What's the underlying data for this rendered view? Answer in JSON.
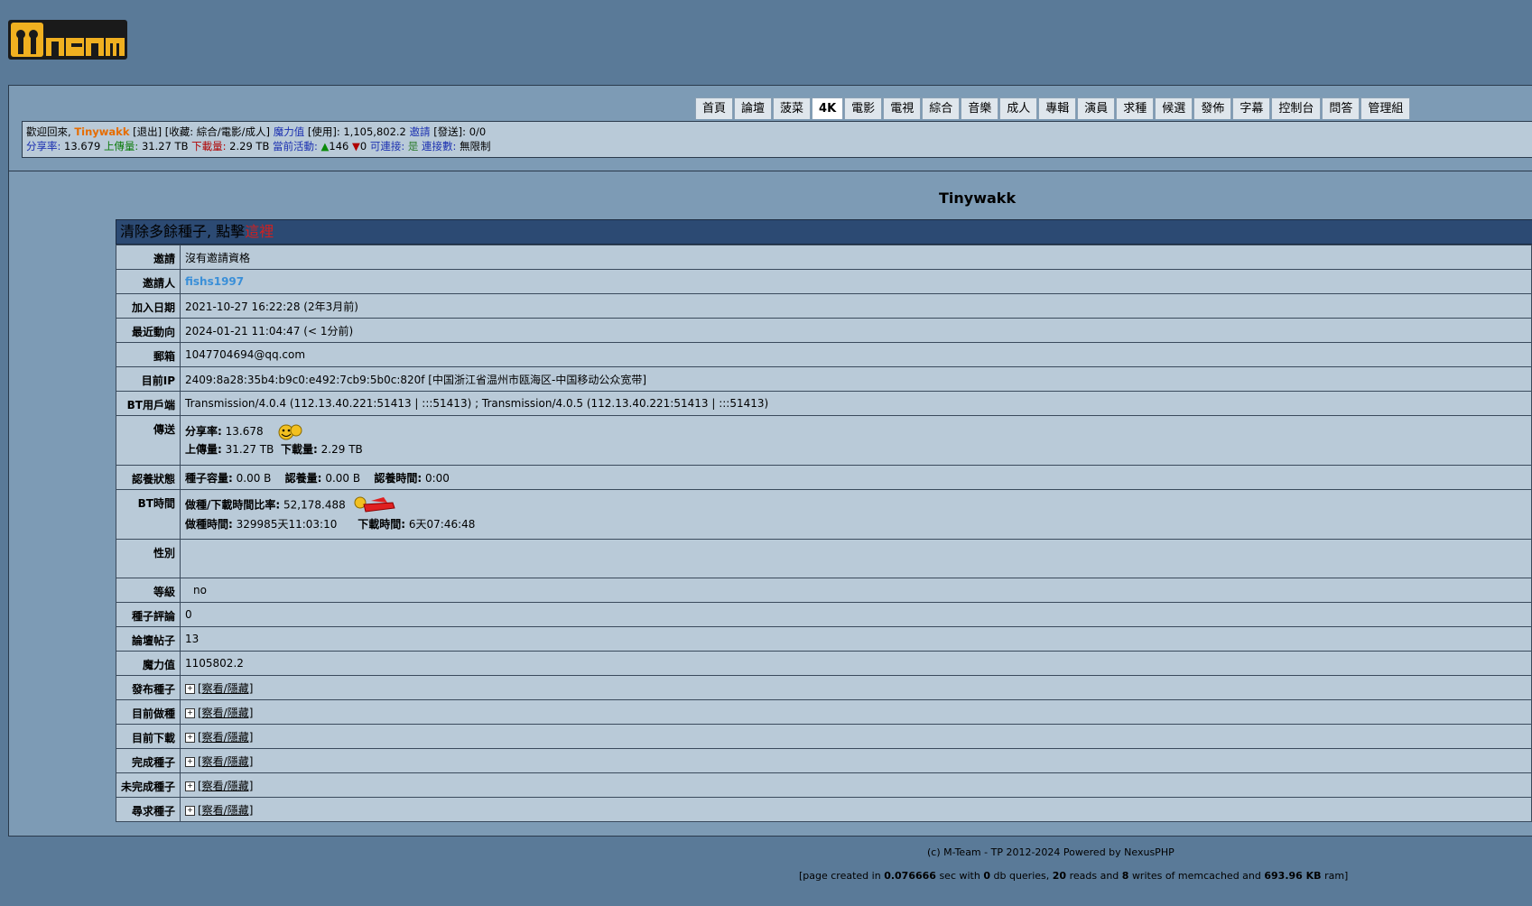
{
  "logo_text": "M-Team",
  "nav": [
    "首頁",
    "論壇",
    "菠菜",
    "4K",
    "電影",
    "電視",
    "綜合",
    "音樂",
    "成人",
    "專輯",
    "演員",
    "求種",
    "候選",
    "發佈",
    "字幕",
    "控制台",
    "問答",
    "管理組"
  ],
  "nav_active_index": 3,
  "infobar": {
    "welcome": "歡迎回來,",
    "username": "Tinywakk",
    "logout": "[退出]",
    "bookmarks": "[收藏:",
    "bookmark_list": "綜合/電影/成人]",
    "magic_label": "魔力值",
    "magic_use": "[使用]: 1,105,802.2",
    "invite_label": "邀請",
    "invite_send": "[發送]: 0/0",
    "ratio_label": "分享率:",
    "ratio_value": "13.679",
    "upload_label": "上傳量:",
    "upload_value": "31.27 TB",
    "download_label": "下載量:",
    "download_value": "2.29 TB",
    "active_label": "當前活動:",
    "seeding": "146",
    "leeching": "0",
    "connectable_label": "可連接:",
    "connectable_value": "是",
    "connections_label": "連接數:",
    "connections_value": "無限制"
  },
  "profile": {
    "username": "Tinywakk",
    "clean_text": "清除多餘種子, 點擊",
    "clean_link": "這裡",
    "rows": {
      "invite": {
        "label": "邀請",
        "value": "沒有邀請資格"
      },
      "inviter": {
        "label": "邀請人",
        "value": "fishs1997"
      },
      "join_date": {
        "label": "加入日期",
        "value": "2021-10-27 16:22:28 (2年3月前)"
      },
      "last_seen": {
        "label": "最近動向",
        "value": "2024-01-21 11:04:47 (< 1分前)"
      },
      "email": {
        "label": "郵箱",
        "value": "1047704694@qq.com"
      },
      "ip": {
        "label": "目前IP",
        "value": "2409:8a28:35b4:b9c0:e492:7cb9:5b0c:820f [中国浙江省温州市瓯海区-中国移动公众宽带]"
      },
      "bt_client": {
        "label": "BT用戶端",
        "value": "Transmission/4.0.4 (112.13.40.221:51413 | :::51413) ; Transmission/4.0.5 (112.13.40.221:51413 | :::51413)"
      },
      "transfer": {
        "label": "傳送",
        "ratio_label": "分享率:",
        "ratio": "13.678",
        "upload_label": "上傳量:",
        "upload": "31.27 TB",
        "download_label": "下載量:",
        "download": "2.29 TB"
      },
      "adopt": {
        "label": "認養狀態",
        "size_label": "種子容量:",
        "size": "0.00 B",
        "adopted_label": "認養量:",
        "adopted": "0.00 B",
        "time_label": "認養時間:",
        "time": "0:00"
      },
      "bt_time": {
        "label": "BT時間",
        "ratio_label": "做種/下載時間比率:",
        "ratio": "52,178.488",
        "seed_label": "做種時間:",
        "seed": "329985天11:03:10",
        "dl_label": "下載時間:",
        "dl": "6天07:46:48"
      },
      "gender": {
        "label": "性別",
        "value": ""
      },
      "level": {
        "label": "等級",
        "value": "no"
      },
      "comments": {
        "label": "種子評論",
        "value": "0"
      },
      "posts": {
        "label": "論壇帖子",
        "value": "13"
      },
      "magic": {
        "label": "魔力值",
        "value": "1105802.2"
      }
    },
    "toggles": [
      {
        "label": "發布種子",
        "link": "[察看/隱藏]"
      },
      {
        "label": "目前做種",
        "link": "[察看/隱藏]"
      },
      {
        "label": "目前下載",
        "link": "[察看/隱藏]"
      },
      {
        "label": "完成種子",
        "link": "[察看/隱藏]"
      },
      {
        "label": "未完成種子",
        "link": "[察看/隱藏]"
      },
      {
        "label": "尋求種子",
        "link": "[察看/隱藏]"
      }
    ]
  },
  "footer": {
    "copyright": "(c) M-Team - TP 2012-2024 Powered by NexusPHP",
    "stats_pre": "[page created in",
    "time": "0.076666",
    "stats_sec": "sec with",
    "queries": "0",
    "stats_db": "db queries,",
    "reads": "20",
    "stats_reads": "reads and",
    "writes": "8",
    "stats_writes": "writes of memcached and",
    "ram": "693.96 KB",
    "stats_ram": "ram]"
  }
}
